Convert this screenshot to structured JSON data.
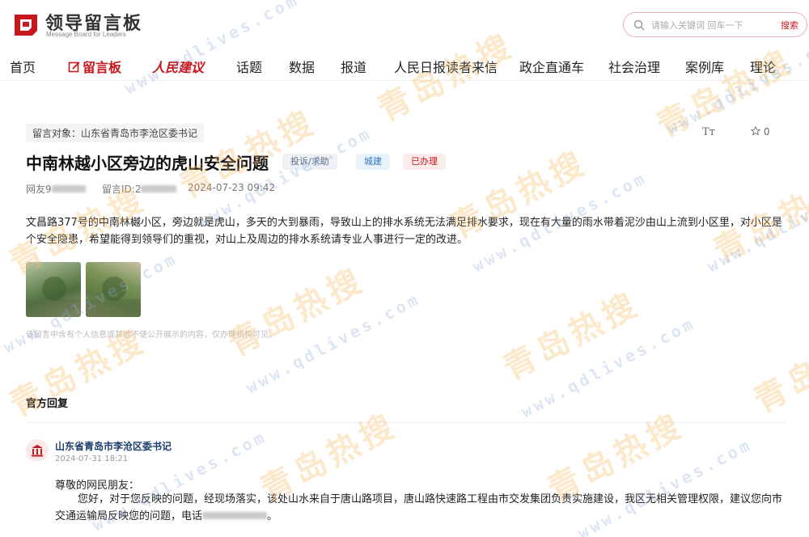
{
  "header": {
    "logo_title": "领导留言板",
    "logo_subtitle": "Message Board for Leaders",
    "search_placeholder": "请输入关键词 回车一下",
    "search_button": "搜索"
  },
  "nav": {
    "items": [
      "首页",
      "留言板",
      "人民建议",
      "话题",
      "数据",
      "报道",
      "人民日报读者来信",
      "政企直通车",
      "社会治理",
      "案例库",
      "理论"
    ]
  },
  "message": {
    "target": "留言对象：山东省青岛市李沧区委书记",
    "title": "中南林越小区旁边的虎山安全问题",
    "tags": [
      "投诉/求助",
      "城建",
      "已办理"
    ],
    "favorite_count": "0",
    "font_size_label": "Tт",
    "author_prefix": "网友9",
    "id_prefix": "留言ID:2",
    "time": "2024-07-23 09:42",
    "content": "文昌路377号的中南林樾小区，旁边就是虎山，多天的大到暴雨，导致山上的排水系统无法满足排水要求，现在有大量的雨水带着泥沙由山上流到小区里，对小区是个安全隐患，希望能得到领导们的重视，对山上及周边的排水系统请专业人事进行一定的改进。",
    "note": "该留言中含有个人信息或其他不便公开展示的内容，仅办理机构可见。"
  },
  "reply": {
    "heading": "官方回复",
    "org": "山东省青岛市李沧区委书记",
    "time": "2024-07-31 18:21",
    "salutation": "尊敬的网民朋友：",
    "body_prefix": "您好，对于您反映的问题，经现场落实，该处山水来自于唐山路项目，唐山路快速路工程由市交发集团负责实施建设，我区无相关管理权限，建议您向市交通运输局反映您的问题，电话",
    "body_suffix": "。"
  },
  "watermark": {
    "cn": "青岛热搜",
    "url": "www.qdlives.com"
  },
  "colors": {
    "brand_red": "#c8161d",
    "org_blue": "#1c3d6e"
  }
}
